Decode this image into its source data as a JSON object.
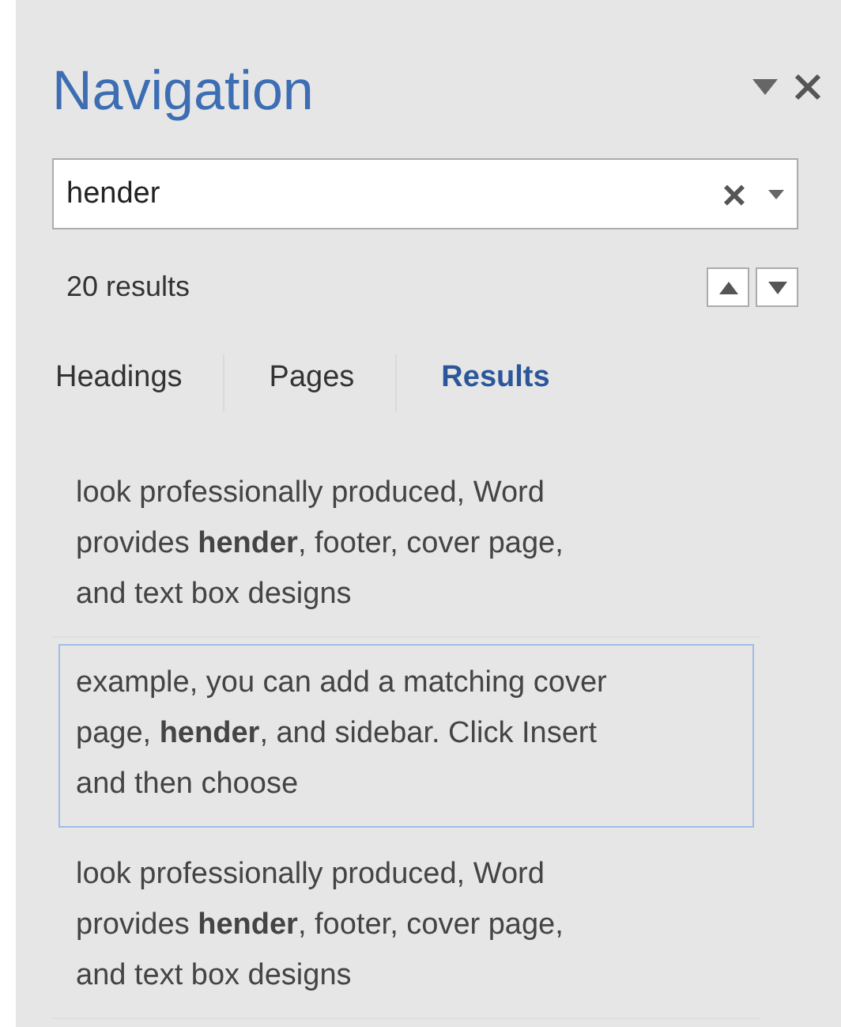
{
  "pane": {
    "title": "Navigation"
  },
  "search": {
    "value": "hender",
    "clear": "×"
  },
  "results_count": "20 results",
  "tabs": [
    {
      "label": "Headings",
      "selected": false
    },
    {
      "label": "Pages",
      "selected": false
    },
    {
      "label": "Results",
      "selected": true
    }
  ],
  "results": [
    {
      "lines": [
        "look professionally produced, Word",
        "provides **hender**, footer, cover page,",
        "and text box designs"
      ],
      "selected": false
    },
    {
      "lines": [
        "example, you can add a matching cover",
        "page, **hender**, and sidebar. Click Insert",
        "and then choose"
      ],
      "selected": true
    },
    {
      "lines": [
        "look professionally produced, Word",
        "provides **hender**, footer, cover page,",
        "and text box designs"
      ],
      "selected": false
    }
  ]
}
